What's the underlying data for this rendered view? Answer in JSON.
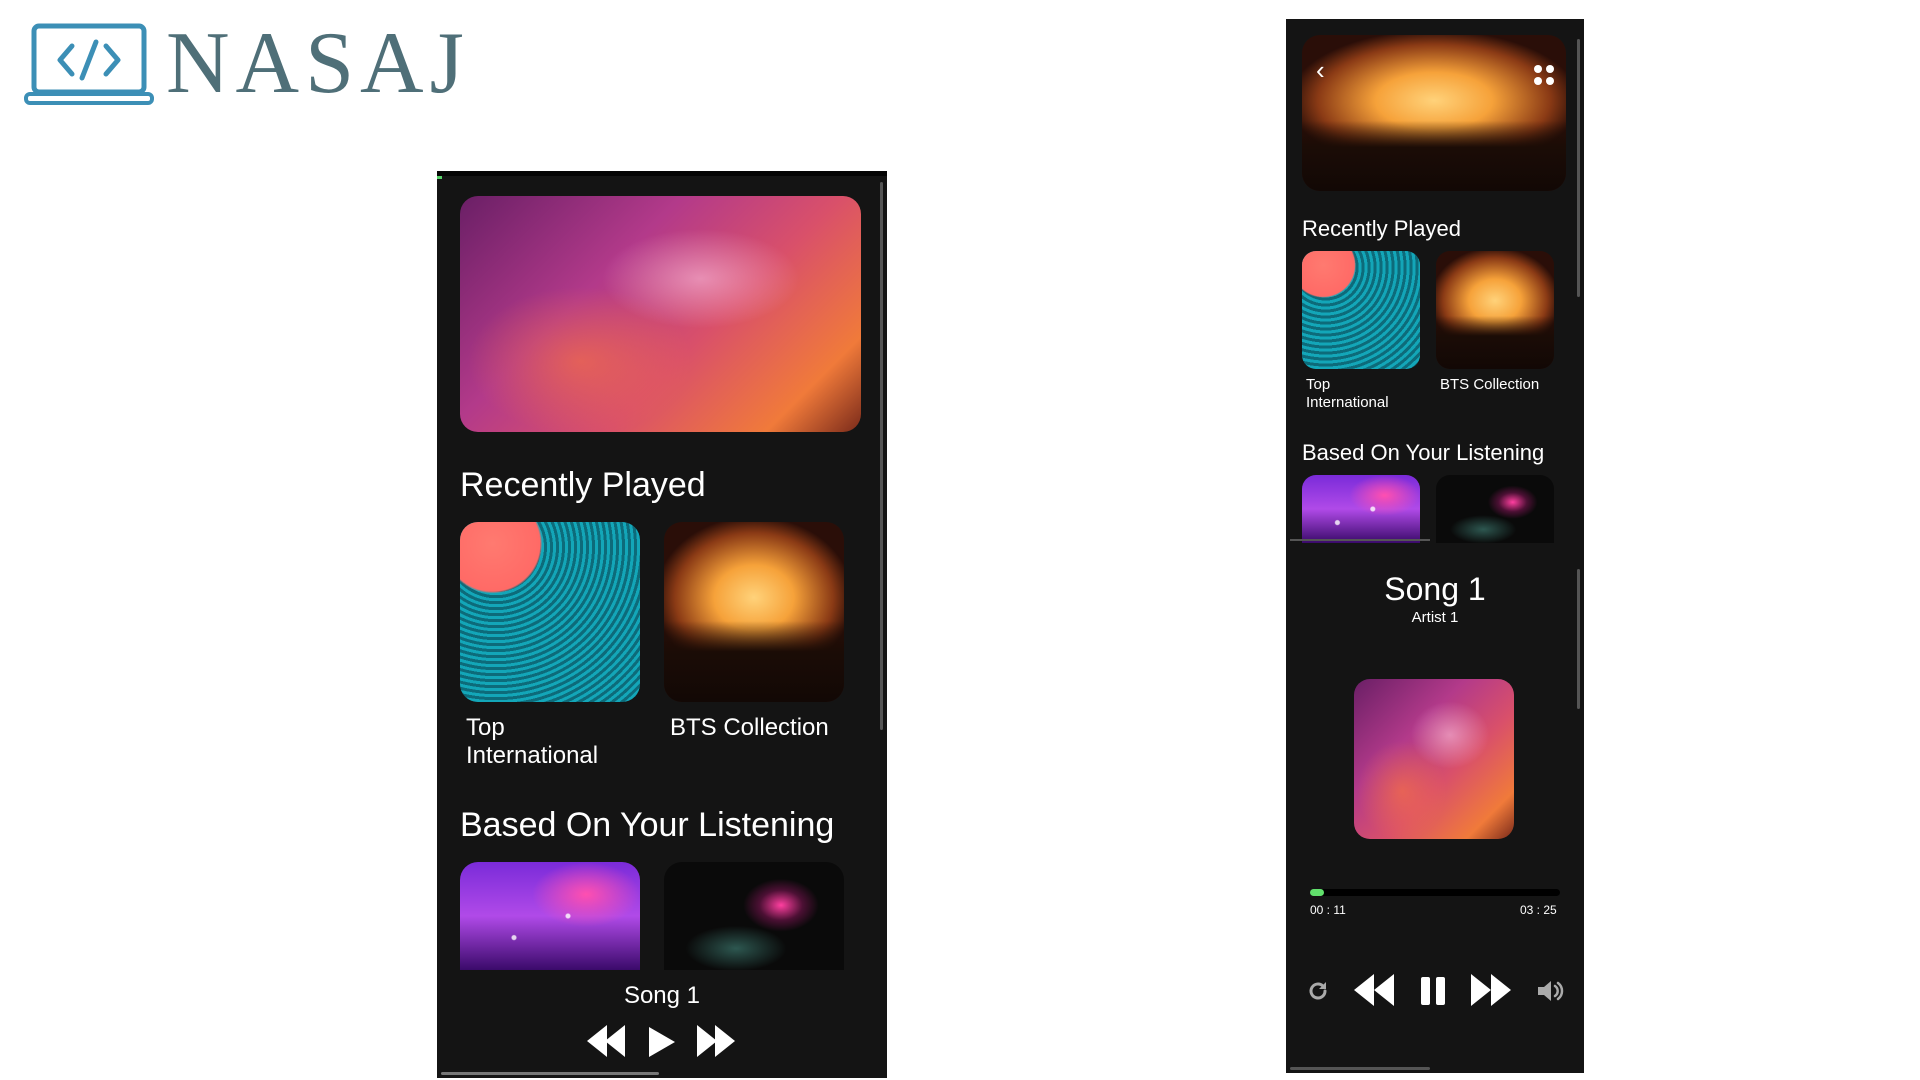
{
  "brand": {
    "name": "NASAJ",
    "icon": "laptop-code-icon",
    "color": "#3c8fb6"
  },
  "phone_left": {
    "recently_played_title": "Recently Played",
    "recently_played": [
      {
        "label": "Top International",
        "art": "vinyl-record"
      },
      {
        "label": "BTS Collection",
        "art": "concert-crowd"
      }
    ],
    "based_on_title": "Based On Your Listening",
    "based_on": [
      {
        "art": "fireworks-crowd"
      },
      {
        "art": "pink-sparks"
      }
    ],
    "now_playing": {
      "title": "Song 1"
    },
    "controls": [
      "rewind-icon",
      "play-icon",
      "fast-forward-icon"
    ]
  },
  "phone_right": {
    "hero": {
      "back_icon": "chevron-left-icon",
      "menu_icon": "grid-dots-icon",
      "art": "concert-crowd"
    },
    "recently_played_title": "Recently Played",
    "recently_played": [
      {
        "label": "Top International",
        "art": "vinyl-record"
      },
      {
        "label": "BTS Collection",
        "art": "concert-crowd"
      }
    ],
    "based_on_title": "Based On Your Listening",
    "now_playing": {
      "title": "Song 1",
      "artist": "Artist 1",
      "elapsed": "00 : 11",
      "duration": "03 : 25",
      "progress": 0.055
    },
    "controls": [
      "repeat-icon",
      "rewind-icon",
      "pause-icon",
      "fast-forward-icon",
      "volume-icon"
    ],
    "accent": "#61e06c"
  }
}
